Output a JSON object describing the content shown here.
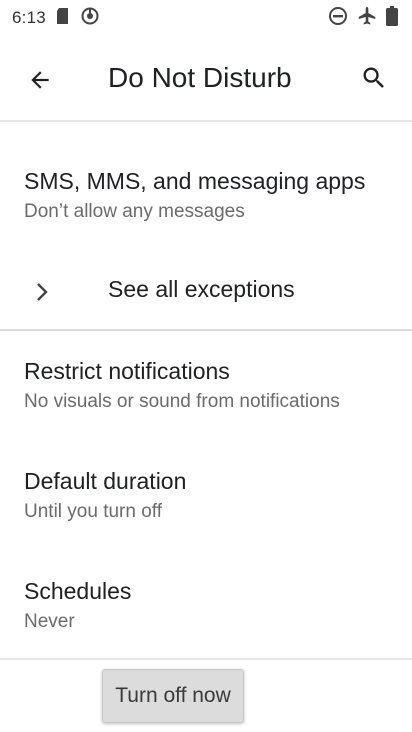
{
  "status_bar": {
    "time": "6:13"
  },
  "app_bar": {
    "title": "Do Not Disturb"
  },
  "items": [
    {
      "title": "SMS, MMS, and messaging apps",
      "subtitle": "Don’t allow any messages"
    },
    {
      "title": "See all exceptions"
    },
    {
      "title": "Restrict notifications",
      "subtitle": "No visuals or sound from notifications"
    },
    {
      "title": "Default duration",
      "subtitle": "Until you turn off"
    },
    {
      "title": "Schedules",
      "subtitle": "Never"
    }
  ],
  "button": {
    "label": "Turn off now"
  },
  "colors": {
    "accent": "#dcdcdc",
    "text_primary": "#202124",
    "text_secondary": "#6b6b6b"
  }
}
